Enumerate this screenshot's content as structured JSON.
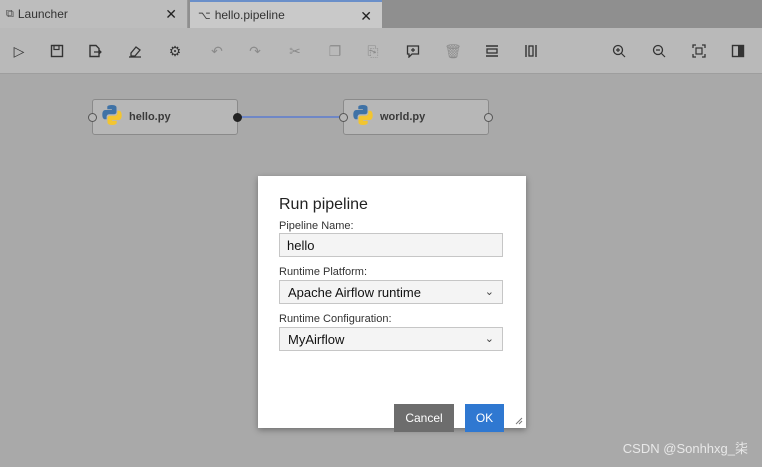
{
  "tabs": [
    {
      "label": "Launcher",
      "icon": "launcher-icon"
    },
    {
      "label": "hello.pipeline",
      "icon": "pipeline-icon"
    }
  ],
  "toolbar": {
    "icons": [
      "run-icon",
      "save-icon",
      "export-icon",
      "clear-icon",
      "runtimes-icon",
      "undo-icon",
      "redo-icon",
      "cut-icon",
      "copy-icon",
      "paste-icon",
      "add-comment-icon",
      "delete-icon",
      "arrange-horizontal-icon",
      "arrange-vertical-icon",
      "zoom-in-icon",
      "zoom-out-icon",
      "fit-to-screen-icon",
      "properties-panel-icon"
    ]
  },
  "nodes": [
    {
      "label": "hello.py"
    },
    {
      "label": "world.py"
    }
  ],
  "dialog": {
    "title": "Run pipeline",
    "name_label": "Pipeline Name:",
    "name_value": "hello",
    "platform_label": "Runtime Platform:",
    "platform_value": "Apache Airflow runtime",
    "config_label": "Runtime Configuration:",
    "config_value": "MyAirflow",
    "cancel_label": "Cancel",
    "ok_label": "OK"
  },
  "watermark": "CSDN @Sonhhxg_柒",
  "colors": {
    "accent": "#2f78d1",
    "link": "#6f87c6",
    "cancel": "#6d6d6d"
  }
}
